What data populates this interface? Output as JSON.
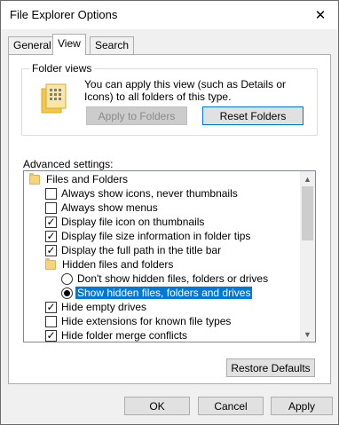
{
  "window": {
    "title": "File Explorer Options",
    "close_glyph": "✕"
  },
  "tabs": [
    {
      "label": "General",
      "active": false
    },
    {
      "label": "View",
      "active": true
    },
    {
      "label": "Search",
      "active": false
    }
  ],
  "folder_views": {
    "legend": "Folder views",
    "description": "You can apply this view (such as Details or Icons) to all folders of this type.",
    "apply_button": "Apply to Folders",
    "reset_button": "Reset Folders"
  },
  "advanced": {
    "label": "Advanced settings:",
    "items": [
      {
        "type": "folder",
        "label": "Files and Folders"
      },
      {
        "type": "checkbox",
        "label": "Always show icons, never thumbnails",
        "checked": false
      },
      {
        "type": "checkbox",
        "label": "Always show menus",
        "checked": false
      },
      {
        "type": "checkbox",
        "label": "Display file icon on thumbnails",
        "checked": true
      },
      {
        "type": "checkbox",
        "label": "Display file size information in folder tips",
        "checked": true
      },
      {
        "type": "checkbox",
        "label": "Display the full path in the title bar",
        "checked": true
      },
      {
        "type": "folder",
        "label": "Hidden files and folders"
      },
      {
        "type": "radio",
        "label": "Don't show hidden files, folders or drives",
        "checked": false
      },
      {
        "type": "radio",
        "label": "Show hidden files, folders and drives",
        "checked": true,
        "selected": true
      },
      {
        "type": "checkbox",
        "label": "Hide empty drives",
        "checked": true
      },
      {
        "type": "checkbox",
        "label": "Hide extensions for known file types",
        "checked": false
      },
      {
        "type": "checkbox",
        "label": "Hide folder merge conflicts",
        "checked": true
      }
    ]
  },
  "restore_button": "Restore Defaults",
  "footer": {
    "ok": "OK",
    "cancel": "Cancel",
    "apply": "Apply"
  },
  "colors": {
    "selection": "#0078d7",
    "panel": "#ffffff",
    "chrome": "#f0f0f0"
  }
}
